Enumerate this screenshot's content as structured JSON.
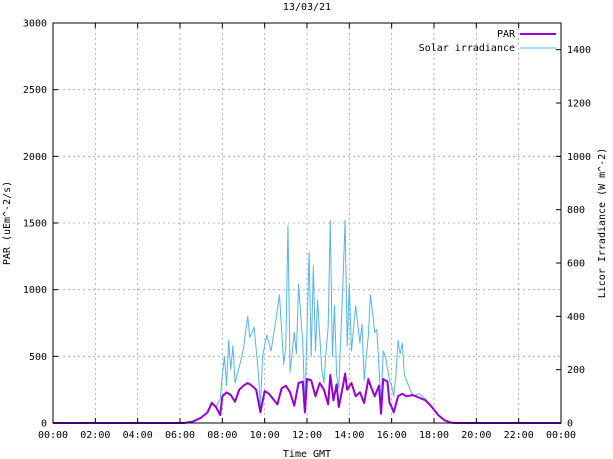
{
  "chart_data": {
    "type": "line",
    "title": "13/03/21",
    "xlabel": "Time GMT",
    "ylabel": "PAR (uEm^-2/s)",
    "y2label": "Licor Irradiance (W m^-2)",
    "x_ticks": [
      "00:00",
      "02:00",
      "04:00",
      "06:00",
      "08:00",
      "10:00",
      "12:00",
      "14:00",
      "16:00",
      "18:00",
      "20:00",
      "22:00",
      "00:00"
    ],
    "xlim_hours": [
      0,
      24
    ],
    "ylim": [
      0,
      3000
    ],
    "y_ticks": [
      "0",
      "500",
      "1000",
      "1500",
      "2000",
      "2500",
      "3000"
    ],
    "y2lim": [
      0,
      1500
    ],
    "y2_ticks": [
      "0",
      "200",
      "400",
      "600",
      "800",
      "1000",
      "1200",
      "1400"
    ],
    "grid": true,
    "legend_position": "top-right",
    "series": [
      {
        "name": "PAR",
        "axis": "left",
        "color": "#9400d3",
        "points": [
          [
            0,
            0
          ],
          [
            6.2,
            0
          ],
          [
            6.6,
            10
          ],
          [
            7.0,
            40
          ],
          [
            7.3,
            80
          ],
          [
            7.5,
            150
          ],
          [
            7.7,
            120
          ],
          [
            7.9,
            60
          ],
          [
            8.0,
            200
          ],
          [
            8.2,
            230
          ],
          [
            8.4,
            210
          ],
          [
            8.6,
            160
          ],
          [
            8.8,
            250
          ],
          [
            9.0,
            280
          ],
          [
            9.2,
            300
          ],
          [
            9.4,
            280
          ],
          [
            9.6,
            250
          ],
          [
            9.8,
            80
          ],
          [
            10.0,
            240
          ],
          [
            10.2,
            220
          ],
          [
            10.4,
            180
          ],
          [
            10.6,
            140
          ],
          [
            10.8,
            260
          ],
          [
            11.0,
            280
          ],
          [
            11.2,
            230
          ],
          [
            11.4,
            130
          ],
          [
            11.6,
            300
          ],
          [
            11.8,
            310
          ],
          [
            11.9,
            80
          ],
          [
            12.0,
            330
          ],
          [
            12.2,
            320
          ],
          [
            12.4,
            200
          ],
          [
            12.6,
            300
          ],
          [
            12.8,
            250
          ],
          [
            13.0,
            140
          ],
          [
            13.1,
            360
          ],
          [
            13.25,
            170
          ],
          [
            13.4,
            290
          ],
          [
            13.5,
            120
          ],
          [
            13.7,
            280
          ],
          [
            13.8,
            370
          ],
          [
            13.9,
            250
          ],
          [
            14.1,
            300
          ],
          [
            14.3,
            200
          ],
          [
            14.5,
            230
          ],
          [
            14.7,
            150
          ],
          [
            14.9,
            330
          ],
          [
            15.0,
            280
          ],
          [
            15.2,
            200
          ],
          [
            15.4,
            280
          ],
          [
            15.5,
            70
          ],
          [
            15.6,
            330
          ],
          [
            15.8,
            310
          ],
          [
            15.9,
            150
          ],
          [
            16.0,
            120
          ],
          [
            16.1,
            80
          ],
          [
            16.3,
            200
          ],
          [
            16.5,
            220
          ],
          [
            16.7,
            200
          ],
          [
            17.0,
            210
          ],
          [
            17.3,
            190
          ],
          [
            17.6,
            170
          ],
          [
            17.9,
            120
          ],
          [
            18.2,
            60
          ],
          [
            18.5,
            20
          ],
          [
            18.8,
            3
          ],
          [
            19.0,
            0
          ],
          [
            24,
            0
          ]
        ]
      },
      {
        "name": "Solar irradiance",
        "axis": "right",
        "color": "#56b4e9",
        "points": [
          [
            0,
            0
          ],
          [
            6.2,
            0
          ],
          [
            6.6,
            5
          ],
          [
            7.0,
            20
          ],
          [
            7.3,
            40
          ],
          [
            7.5,
            80
          ],
          [
            7.7,
            60
          ],
          [
            7.9,
            90
          ],
          [
            8.0,
            180
          ],
          [
            8.1,
            250
          ],
          [
            8.2,
            140
          ],
          [
            8.3,
            310
          ],
          [
            8.4,
            200
          ],
          [
            8.5,
            290
          ],
          [
            8.6,
            150
          ],
          [
            8.8,
            210
          ],
          [
            9.0,
            280
          ],
          [
            9.2,
            400
          ],
          [
            9.3,
            320
          ],
          [
            9.5,
            360
          ],
          [
            9.7,
            190
          ],
          [
            9.8,
            60
          ],
          [
            9.9,
            250
          ],
          [
            10.1,
            330
          ],
          [
            10.3,
            270
          ],
          [
            10.5,
            370
          ],
          [
            10.7,
            480
          ],
          [
            10.9,
            220
          ],
          [
            11.0,
            290
          ],
          [
            11.1,
            740
          ],
          [
            11.2,
            190
          ],
          [
            11.4,
            340
          ],
          [
            11.5,
            260
          ],
          [
            11.6,
            520
          ],
          [
            11.8,
            300
          ],
          [
            11.9,
            60
          ],
          [
            12.1,
            640
          ],
          [
            12.2,
            250
          ],
          [
            12.3,
            590
          ],
          [
            12.4,
            270
          ],
          [
            12.5,
            460
          ],
          [
            12.7,
            200
          ],
          [
            12.8,
            150
          ],
          [
            12.9,
            270
          ],
          [
            13.0,
            360
          ],
          [
            13.1,
            760
          ],
          [
            13.2,
            250
          ],
          [
            13.3,
            440
          ],
          [
            13.4,
            180
          ],
          [
            13.5,
            130
          ],
          [
            13.7,
            530
          ],
          [
            13.8,
            760
          ],
          [
            13.9,
            290
          ],
          [
            14.0,
            520
          ],
          [
            14.1,
            270
          ],
          [
            14.3,
            440
          ],
          [
            14.5,
            300
          ],
          [
            14.6,
            370
          ],
          [
            14.7,
            160
          ],
          [
            14.9,
            330
          ],
          [
            15.0,
            480
          ],
          [
            15.2,
            340
          ],
          [
            15.3,
            350
          ],
          [
            15.5,
            70
          ],
          [
            15.6,
            270
          ],
          [
            15.7,
            250
          ],
          [
            15.9,
            160
          ],
          [
            16.0,
            140
          ],
          [
            16.1,
            100
          ],
          [
            16.2,
            180
          ],
          [
            16.3,
            310
          ],
          [
            16.4,
            260
          ],
          [
            16.5,
            300
          ],
          [
            16.6,
            180
          ],
          [
            16.8,
            140
          ],
          [
            17.0,
            100
          ],
          [
            17.3,
            110
          ],
          [
            17.6,
            90
          ],
          [
            17.9,
            60
          ],
          [
            18.2,
            30
          ],
          [
            18.5,
            10
          ],
          [
            18.8,
            2
          ],
          [
            19.0,
            0
          ],
          [
            24,
            0
          ]
        ]
      }
    ]
  }
}
